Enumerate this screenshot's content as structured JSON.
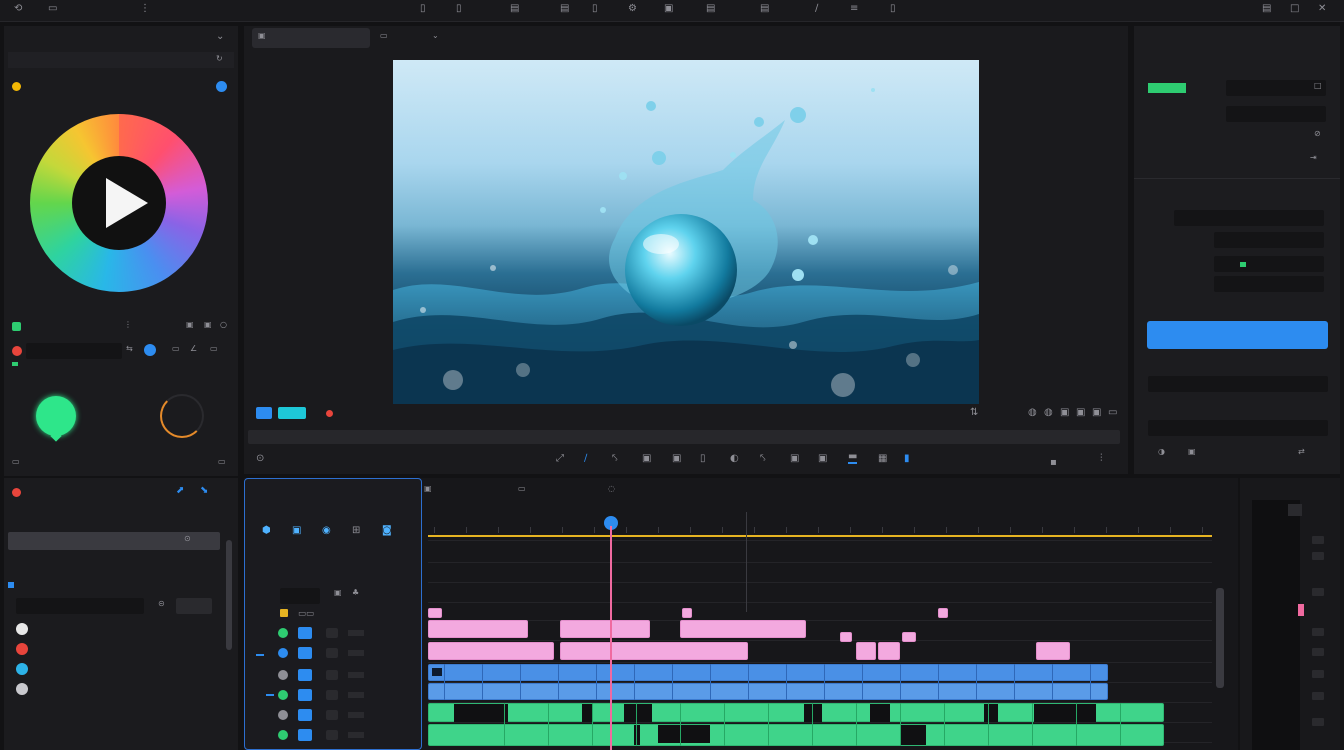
{
  "menubar": {
    "items": [
      "",
      "",
      "",
      ""
    ],
    "tools": [
      "",
      "",
      "",
      "",
      "",
      "",
      "",
      "",
      "",
      ""
    ]
  },
  "left_top": {
    "title": "",
    "sub_left": "",
    "sub_right": "",
    "section": "",
    "section2": "",
    "labels": [
      "",
      "",
      ""
    ]
  },
  "preview": {
    "tabs": [
      "",
      ""
    ],
    "badges": [
      "",
      ""
    ],
    "status": "",
    "time_left": "",
    "time_right": ""
  },
  "right": {
    "header": "",
    "group2": "",
    "button": "",
    "row_labels": [
      "",
      "",
      "",
      "",
      "",
      "",
      "",
      "",
      ""
    ]
  },
  "media": {
    "title": "",
    "rows": [
      "",
      "",
      "",
      "",
      ""
    ]
  },
  "timeline": {
    "panel_title": "",
    "tabs": [
      "",
      "",
      ""
    ],
    "project_title": "",
    "ruler_labels": [
      "",
      "",
      "",
      "",
      "",
      "",
      "",
      "",
      "",
      "",
      "",
      ""
    ],
    "clip_labels": [
      "",
      "",
      "",
      "",
      "",
      "",
      "",
      ""
    ]
  },
  "colors": {
    "accent": "#2d8cf0",
    "pink_clip": "#f3a9df",
    "blue_clip": "#4a90e6",
    "green_clip": "#3fd48a",
    "playhead": "#f06aa0",
    "ruler_line": "#e6b422"
  }
}
